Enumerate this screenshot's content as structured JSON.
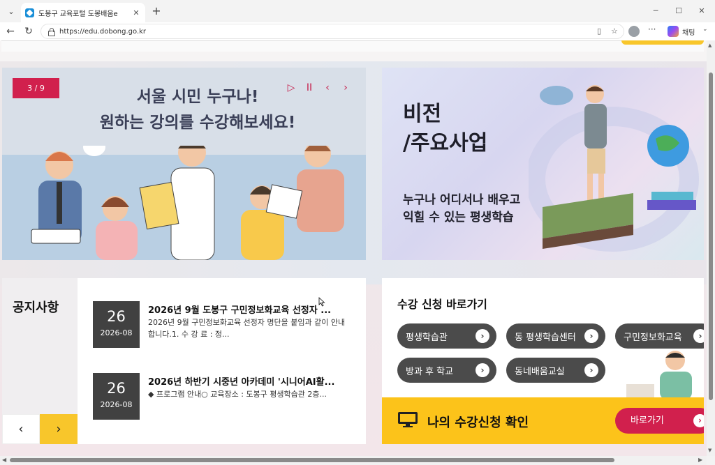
{
  "browser": {
    "tab_title": "도봉구 교육포털 도봉배움e",
    "url": "https://edu.dobong.go.kr",
    "chat_label": "채팅"
  },
  "icons": {
    "tab_menu": "chevron-down-icon",
    "favicon": "site-favicon",
    "back": "back-arrow-icon",
    "reload": "reload-icon",
    "reader": "reader-view-icon",
    "favorite": "star-icon"
  },
  "banner_left": {
    "counter": "3 / 9",
    "headline_line1": "서울 시민 누구나!",
    "headline_line2": "원하는 강의를 수강해보세요!",
    "controls": {
      "play": "▷",
      "pause": "II",
      "prev": "‹",
      "next": "›"
    }
  },
  "banner_right": {
    "title_line1": "비전",
    "title_line2": "/주요사업",
    "sub_line1": "누구나 어디서나 배우고",
    "sub_line2": "익힐 수 있는 평생학습"
  },
  "notice": {
    "title": "공지사항",
    "posts": [
      {
        "day": "26",
        "month": "2026-08",
        "title": "2026년 9월 도봉구 구민정보화교육 선정자 ...",
        "body": "2026년 9월 구민정보화교육 선정자 명단을 붙임과 같이 안내합니다.1. 수 강 료 : 정..."
      },
      {
        "day": "26",
        "month": "2026-08",
        "title": "2026년 하반기 시중년 아카데미 '시니어AI활...",
        "body": "◆ 프로그램 안내○ 교육장소 : 도봉구 평생학습관 2층..."
      }
    ]
  },
  "course": {
    "title": "수강 신청 바로가기",
    "buttons": [
      "평생학습관",
      "동 평생학습센터",
      "구민정보화교육",
      "방과 후 학교",
      "동네배움교실"
    ],
    "check_title": "나의 수강신청 확인",
    "go_label": "바로가기"
  },
  "colors": {
    "accent_red": "#d1204d",
    "accent_yellow": "#fcc31a",
    "pill_dark": "#4b4b4b"
  }
}
